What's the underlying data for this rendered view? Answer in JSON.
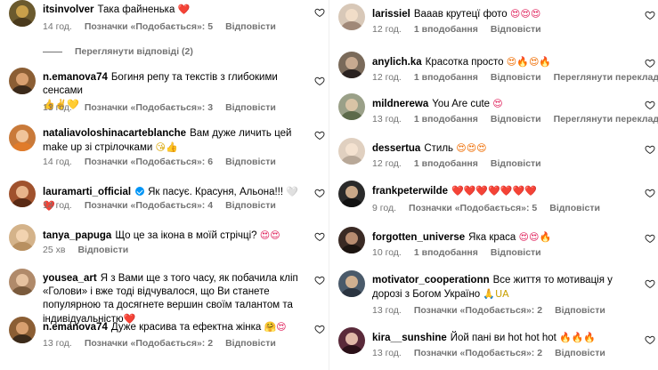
{
  "colors": {
    "meta": "#737373",
    "verified": "#0095f6"
  },
  "left": [
    {
      "user": "itsinvolver",
      "text": "Така файненька",
      "emoji": "❤️",
      "time": "14 год.",
      "likes": "Позначки «Подобається»: 5",
      "reply": "Відповісти",
      "view_replies": "Переглянути відповіді (2)"
    },
    {
      "user": "n.emanova74",
      "text": "Богиня репу та текстів з глибокими сенсами",
      "emoji": "👍✌️💛",
      "time": "13 год.",
      "likes": "Позначки «Подобається»: 3",
      "reply": "Відповісти"
    },
    {
      "user": "nataliavoloshinacarteblanche",
      "text": "Вам дуже личить цей make up зі стрілочками",
      "emoji": "😘👍",
      "time": "14 год.",
      "likes": "Позначки «Подобається»: 6",
      "reply": "Відповісти"
    },
    {
      "user": "lauramarti_official",
      "text": "Як пасує. Красуня, Альона!!!",
      "emoji": "🤍❤️",
      "time": "14 год.",
      "likes": "Позначки «Подобається»: 4",
      "reply": "Відповісти"
    },
    {
      "user": "tanya_papuga",
      "text": "Що це за ікона в моїй стрічці?",
      "emoji": "😍😍",
      "time": "25 хв",
      "likes": "",
      "reply": "Відповісти"
    },
    {
      "user": "yousea_art",
      "text": "Я з Вами ще з того часу, як побачила кліп «Голови» і вже тоді відчувалося, що Ви станете популярною та досягнете вершин своїм талантом та індивідуальністю",
      "emoji": "❤️",
      "time": "13 год.",
      "likes": "Позначки «Подобається»: 4",
      "reply": "Відповісти"
    },
    {
      "user": "n.emanova74",
      "text": "Дуже красива та ефектна жінка",
      "emoji": "🤗😍",
      "time": "13 год.",
      "likes": "Позначки «Подобається»: 2",
      "reply": "Відповісти"
    }
  ],
  "right": [
    {
      "user": "larissiel",
      "text": "Вааав крутецї фото",
      "emoji": "😍😍😍",
      "time": "12 год.",
      "likes": "1 вподобання",
      "reply": "Відповісти"
    },
    {
      "user": "anylich.ka",
      "text": "Красотка просто",
      "emoji": "😍🔥😍🔥",
      "time": "12 год.",
      "likes": "1 вподобання",
      "reply": "Відповісти",
      "translate": "Переглянути переклад"
    },
    {
      "user": "mildnerewa",
      "text": "You Are cute",
      "emoji": "😍",
      "time": "13 год.",
      "likes": "1 вподобання",
      "reply": "Відповісти",
      "translate": "Переглянути переклад"
    },
    {
      "user": "dessertua",
      "text": "Стиль",
      "emoji": "😍😍😍",
      "time": "12 год.",
      "likes": "1 вподобання",
      "reply": "Відповісти"
    },
    {
      "user": "frankpeterwilde",
      "text": "",
      "emoji": "❤️❤️❤️❤️❤️❤️❤️",
      "time": "9 год.",
      "likes": "Позначки «Подобається»: 5",
      "reply": "Відповісти"
    },
    {
      "user": "forgotten_universe",
      "text": "Яка краса",
      "emoji": "😍😍🔥",
      "time": "10 год.",
      "likes": "1 вподобання",
      "reply": "Відповісти"
    },
    {
      "user": "motivator_cooperationn",
      "text": "Все життя то мотивація у дорозі з Богом Україно",
      "emoji": "🙏UA",
      "time": "13 год.",
      "likes": "Позначки «Подобається»: 2",
      "reply": "Відповісти"
    },
    {
      "user": "kira__sunshine",
      "text": "Йой пані ви hot hot hot",
      "emoji": "🔥🔥🔥",
      "time": "13 год.",
      "likes": "Позначки «Подобається»: 2",
      "reply": "Відповісти"
    }
  ]
}
